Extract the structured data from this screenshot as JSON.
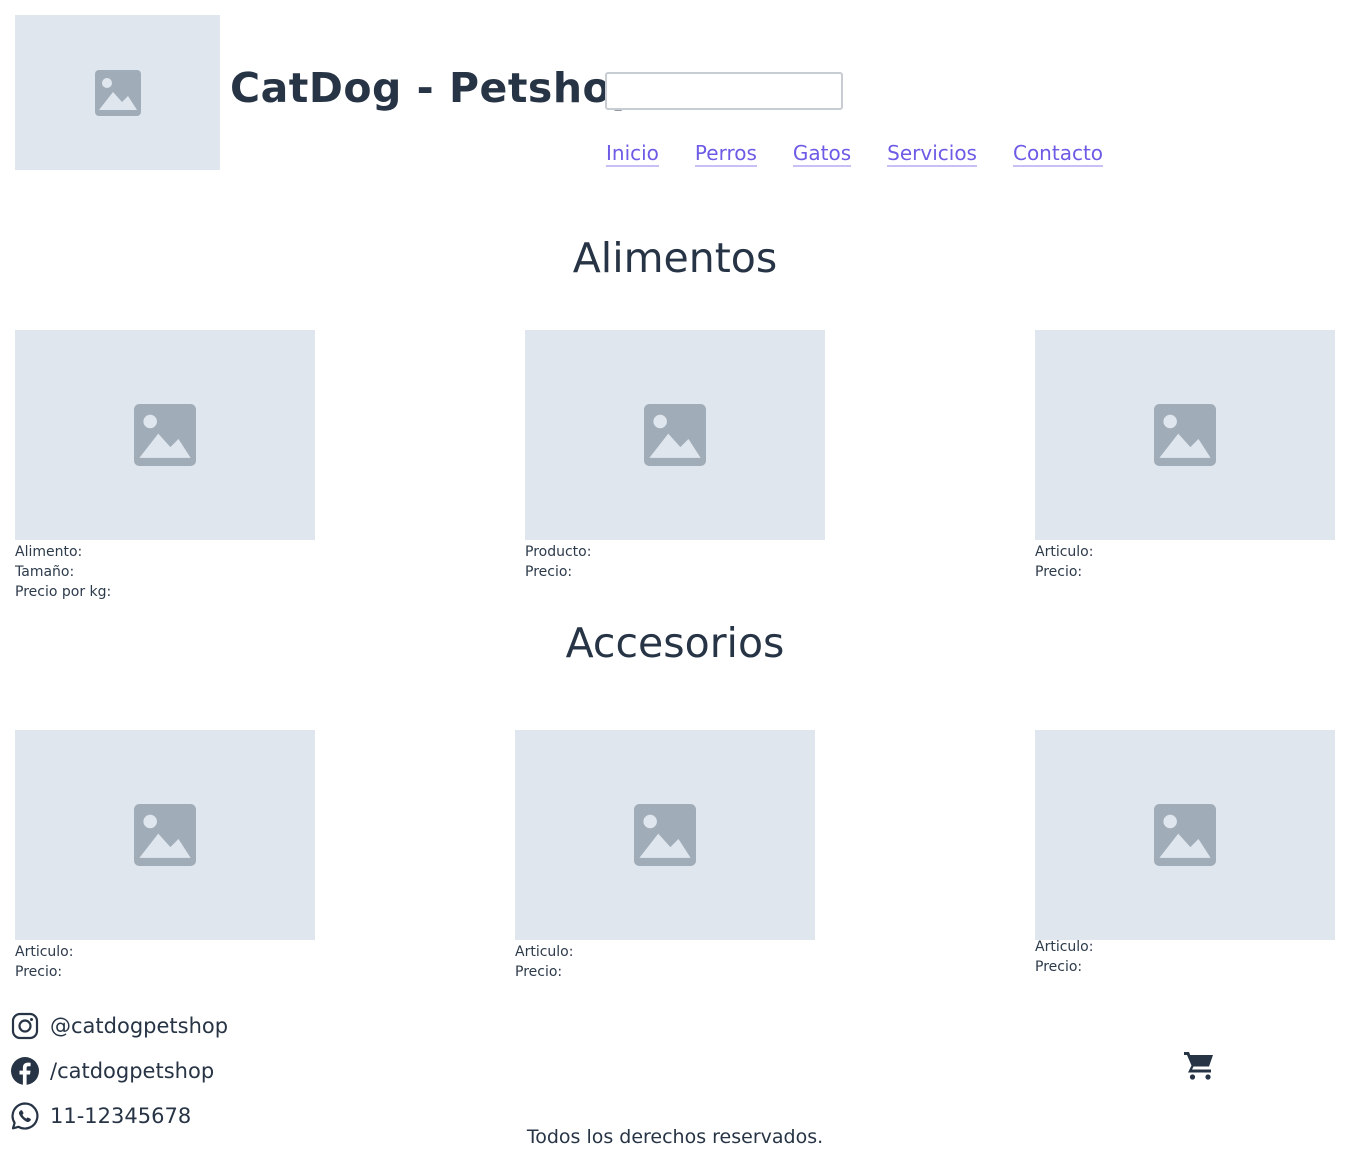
{
  "header": {
    "logo_icon": "image-placeholder-icon",
    "title": "CatDog - Petshop",
    "search": {
      "value": "",
      "placeholder": ""
    },
    "nav": [
      "Inicio",
      "Perros",
      "Gatos",
      "Servicios",
      "Contacto"
    ]
  },
  "sections": {
    "alimentos": {
      "title": "Alimentos",
      "cards": [
        {
          "lines": [
            "Alimento:",
            "Tamaño:",
            "Precio por kg:"
          ]
        },
        {
          "lines": [
            "Producto:",
            "Precio:"
          ]
        },
        {
          "lines": [
            "Articulo:",
            "Precio:"
          ]
        }
      ]
    },
    "accesorios": {
      "title": "Accesorios",
      "cards": [
        {
          "lines": [
            "Articulo:",
            "Precio:"
          ]
        },
        {
          "lines": [
            "Articulo:",
            "Precio:"
          ]
        },
        {
          "lines": [
            "Articulo:",
            "Precio:"
          ]
        }
      ]
    }
  },
  "footer": {
    "social": [
      {
        "icon": "instagram-icon",
        "text": "@catdogpetshop"
      },
      {
        "icon": "facebook-icon",
        "text": "/catdogpetshop"
      },
      {
        "icon": "whatsapp-icon",
        "text": "11-12345678"
      }
    ],
    "cart_icon": "shopping-cart-icon",
    "copyright": "Todos los derechos reservados."
  },
  "colors": {
    "link": "#6d5be6",
    "placeholder_bg": "#e0e6ee",
    "placeholder_icon": "#a0adb9",
    "text": "#273445"
  }
}
